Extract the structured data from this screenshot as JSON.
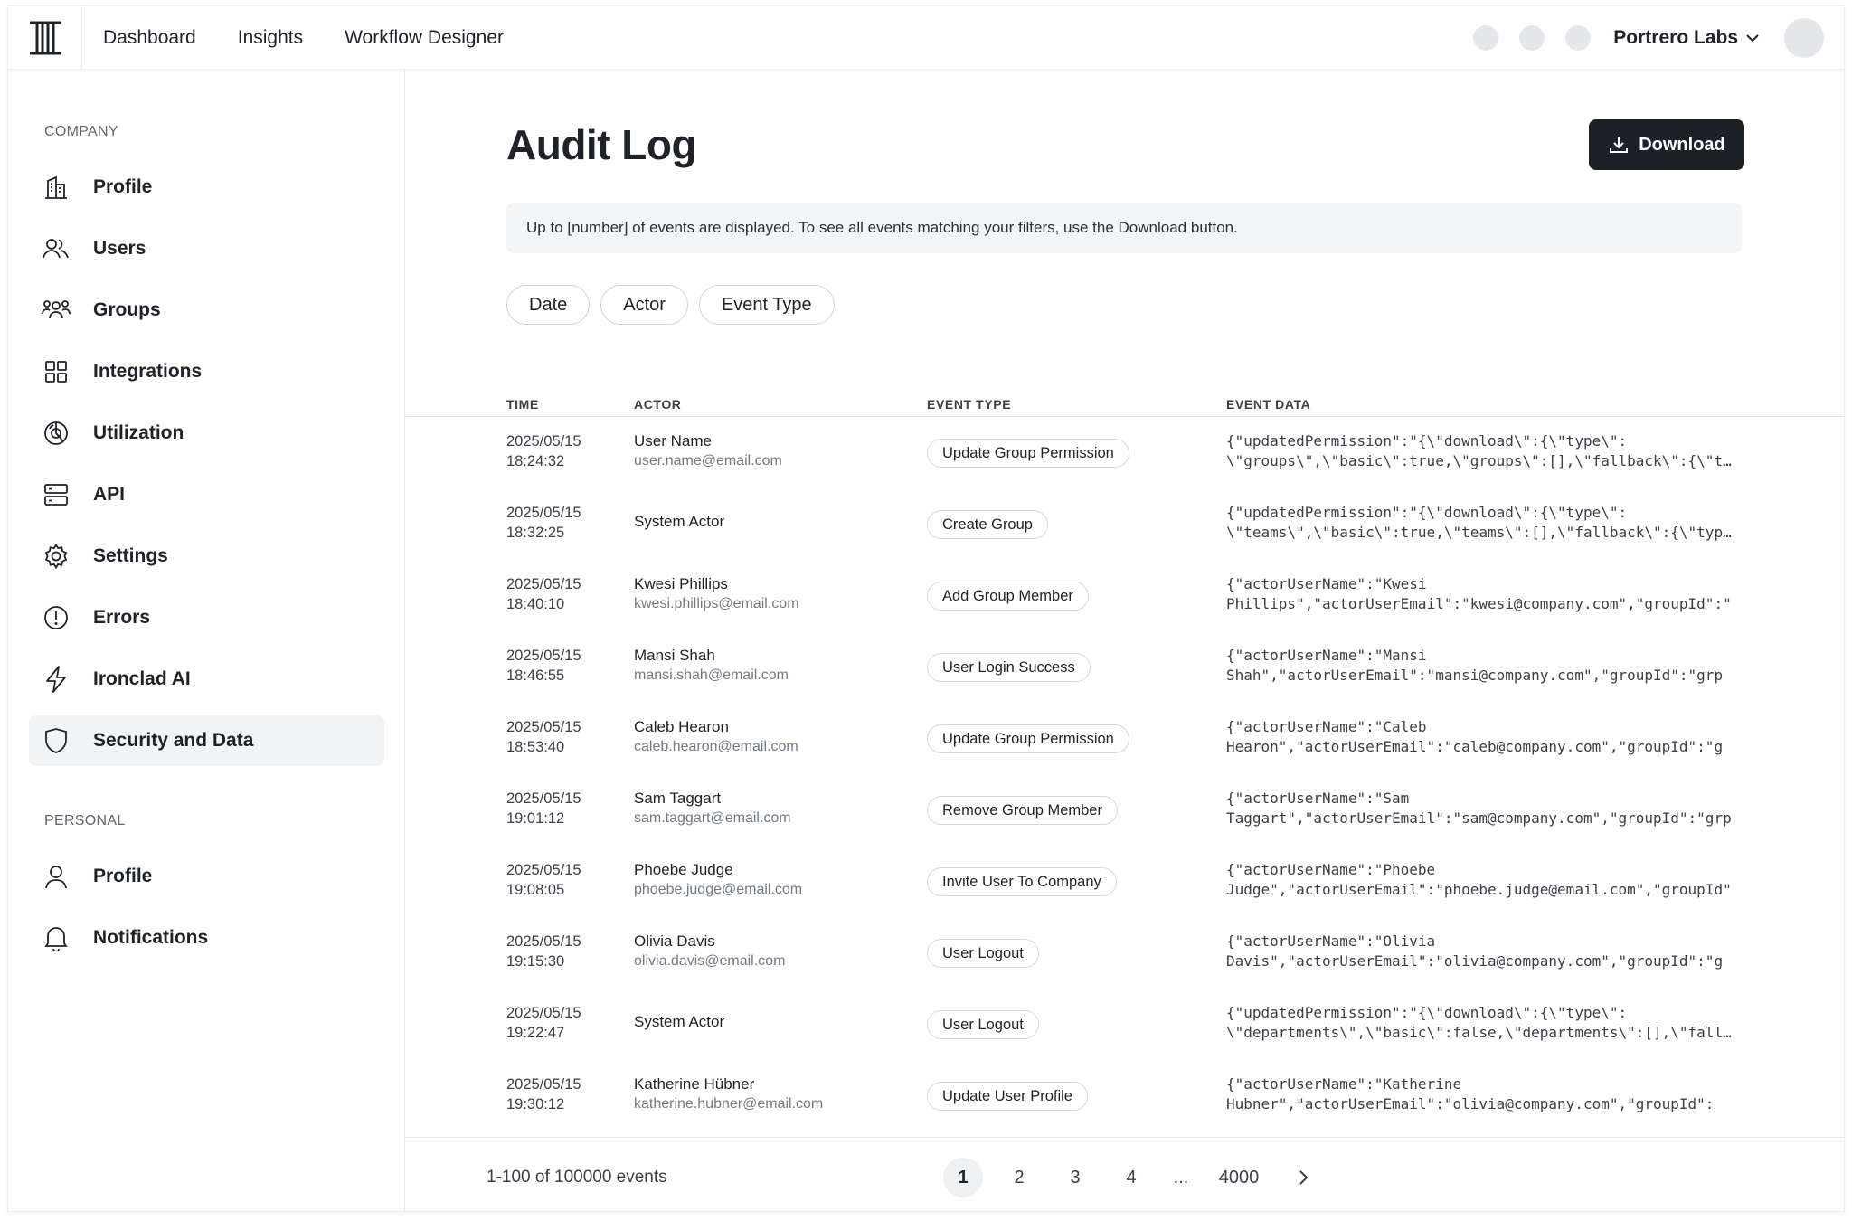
{
  "topbar": {
    "nav": [
      "Dashboard",
      "Insights",
      "Workflow Designer"
    ],
    "org_name": "Portrero Labs"
  },
  "sidebar": {
    "company_label": "COMPANY",
    "company_items": [
      {
        "label": "Profile",
        "icon": "building-icon"
      },
      {
        "label": "Users",
        "icon": "users-icon"
      },
      {
        "label": "Groups",
        "icon": "groups-icon"
      },
      {
        "label": "Integrations",
        "icon": "grid-icon"
      },
      {
        "label": "Utilization",
        "icon": "chart-pie-icon"
      },
      {
        "label": "API",
        "icon": "server-icon"
      },
      {
        "label": "Settings",
        "icon": "gear-icon"
      },
      {
        "label": "Errors",
        "icon": "alert-circle-icon"
      },
      {
        "label": "Ironclad AI",
        "icon": "lightning-icon"
      },
      {
        "label": "Security and Data",
        "icon": "shield-icon",
        "active": true
      }
    ],
    "personal_label": "PERSONAL",
    "personal_items": [
      {
        "label": "Profile",
        "icon": "user-icon"
      },
      {
        "label": "Notifications",
        "icon": "bell-icon"
      }
    ]
  },
  "main": {
    "title": "Audit Log",
    "download_label": "Download",
    "notice": "Up to [number] of events are displayed. To see all events matching your filters, use the Download button.",
    "filters": [
      "Date",
      "Actor",
      "Event Type"
    ],
    "columns": [
      "TIME",
      "ACTOR",
      "EVENT TYPE",
      "EVENT DATA"
    ],
    "rows": [
      {
        "date": "2025/05/15",
        "time": "18:24:32",
        "actor": "User Name",
        "email": "user.name@email.com",
        "event": "Update Group Permission",
        "data1": "{\"updatedPermission\":\"{\\\"download\\\":{\\\"type\\\":",
        "data2": "\\\"groups\\\",\\\"basic\\\":true,\\\"groups\\\":[],\\\"fallback\\\":{\\\"type\\\""
      },
      {
        "date": "2025/05/15",
        "time": "18:32:25",
        "actor": "System Actor",
        "email": "",
        "event": "Create Group",
        "data1": "{\"updatedPermission\":\"{\\\"download\\\":{\\\"type\\\":",
        "data2": "\\\"teams\\\",\\\"basic\\\":true,\\\"teams\\\":[],\\\"fallback\\\":{\\\"type\\\""
      },
      {
        "date": "2025/05/15",
        "time": "18:40:10",
        "actor": "Kwesi Phillips",
        "email": "kwesi.phillips@email.com",
        "event": "Add Group Member",
        "data1": "{\"actorUserName\":\"Kwesi",
        "data2": "Phillips\",\"actorUserEmail\":\"kwesi@company.com\",\"groupId\":\""
      },
      {
        "date": "2025/05/15",
        "time": "18:46:55",
        "actor": "Mansi Shah",
        "email": "mansi.shah@email.com",
        "event": "User Login Success",
        "data1": "{\"actorUserName\":\"Mansi",
        "data2": "Shah\",\"actorUserEmail\":\"mansi@company.com\",\"groupId\":\"grp"
      },
      {
        "date": "2025/05/15",
        "time": "18:53:40",
        "actor": "Caleb Hearon",
        "email": "caleb.hearon@email.com",
        "event": "Update Group Permission",
        "data1": "{\"actorUserName\":\"Caleb",
        "data2": "Hearon\",\"actorUserEmail\":\"caleb@company.com\",\"groupId\":\"g"
      },
      {
        "date": "2025/05/15",
        "time": "19:01:12",
        "actor": "Sam Taggart",
        "email": "sam.taggart@email.com",
        "event": "Remove Group Member",
        "data1": "{\"actorUserName\":\"Sam",
        "data2": "Taggart\",\"actorUserEmail\":\"sam@company.com\",\"groupId\":\"grp"
      },
      {
        "date": "2025/05/15",
        "time": "19:08:05",
        "actor": "Phoebe Judge",
        "email": "phoebe.judge@email.com",
        "event": "Invite User To Company",
        "data1": "{\"actorUserName\":\"Phoebe",
        "data2": "Judge\",\"actorUserEmail\":\"phoebe.judge@email.com\",\"groupId\""
      },
      {
        "date": "2025/05/15",
        "time": "19:15:30",
        "actor": "Olivia Davis",
        "email": "olivia.davis@email.com",
        "event": "User Logout",
        "data1": "{\"actorUserName\":\"Olivia",
        "data2": "Davis\",\"actorUserEmail\":\"olivia@company.com\",\"groupId\":\"g"
      },
      {
        "date": "2025/05/15",
        "time": "19:22:47",
        "actor": "System Actor",
        "email": "",
        "event": "User Logout",
        "data1": "{\"updatedPermission\":\"{\\\"download\\\":{\\\"type\\\":",
        "data2": "\\\"departments\\\",\\\"basic\\\":false,\\\"departments\\\":[],\\\"fallback"
      },
      {
        "date": "2025/05/15",
        "time": "19:30:12",
        "actor": "Katherine Hübner",
        "email": "katherine.hubner@email.com",
        "event": "Update User Profile",
        "data1": "{\"actorUserName\":\"Katherine",
        "data2": "Hubner\",\"actorUserEmail\":\"olivia@company.com\",\"groupId\":"
      }
    ],
    "pager": {
      "summary": "1-100 of 100000 events",
      "pages": [
        "1",
        "2",
        "3",
        "4",
        "...",
        "4000"
      ],
      "current": "1"
    }
  }
}
